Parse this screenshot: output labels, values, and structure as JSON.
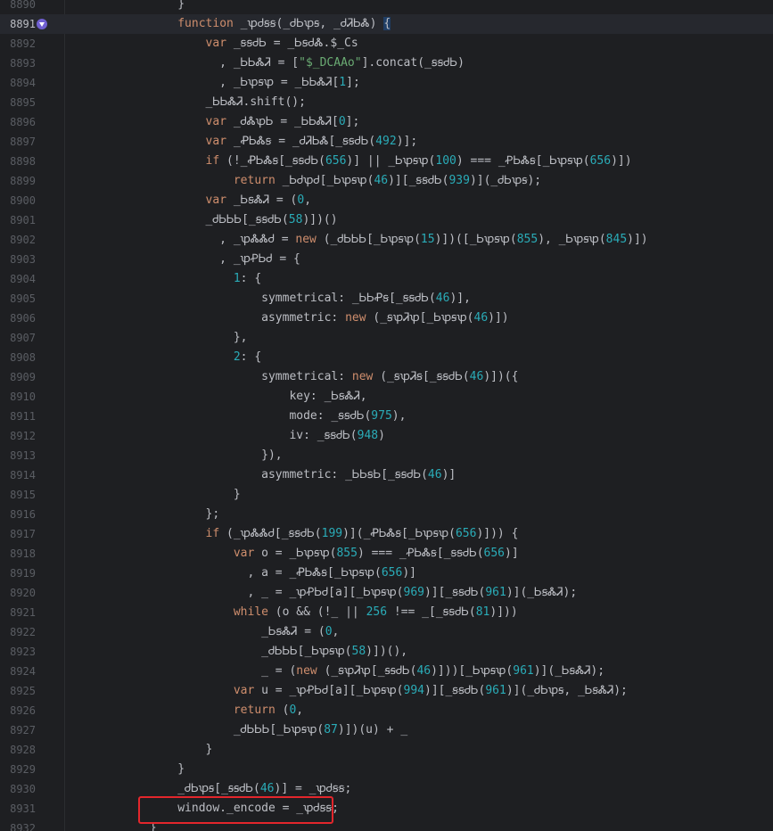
{
  "editor": {
    "accent_color": "#e3262c",
    "gutter_icon": "implementation-icon",
    "lines": [
      {
        "n": "8890",
        "segs": [
          {
            "t": "                }"
          }
        ]
      },
      {
        "n": "8891",
        "current": true,
        "segs": [
          {
            "t": "                "
          },
          {
            "t": "function",
            "c": "kw"
          },
          {
            "t": " _ꝕᏧꞩꞩ(_ᏧᏏꝕꞩ, _ᏧᏘᏏᏜ) "
          },
          {
            "t": "{",
            "c": "brk"
          }
        ]
      },
      {
        "n": "8892",
        "segs": [
          {
            "t": "                    "
          },
          {
            "t": "var",
            "c": "kw"
          },
          {
            "t": " _ꞩꞩᏧᏏ = _ᏏꞩᏧᏜ.$_Cs"
          }
        ]
      },
      {
        "n": "8893",
        "segs": [
          {
            "t": "                      , _ᏏᏏᏜᏘ = ["
          },
          {
            "t": "\"$_DCAAo\"",
            "c": "str"
          },
          {
            "t": "].concat(_ꞩꞩᏧᏏ)"
          }
        ]
      },
      {
        "n": "8894",
        "segs": [
          {
            "t": "                      , _Ꮟꝕꞩꝕ = _ᏏᏏᏜᏘ["
          },
          {
            "t": "1",
            "c": "num"
          },
          {
            "t": "];"
          }
        ]
      },
      {
        "n": "8895",
        "segs": [
          {
            "t": "                    _ᏏᏏᏜᏘ.shift();"
          }
        ]
      },
      {
        "n": "8896",
        "segs": [
          {
            "t": "                    "
          },
          {
            "t": "var",
            "c": "kw"
          },
          {
            "t": " _ᏧᏜꝕᏏ = _ᏏᏏᏜᏘ["
          },
          {
            "t": "0",
            "c": "num"
          },
          {
            "t": "];"
          }
        ]
      },
      {
        "n": "8897",
        "segs": [
          {
            "t": "                    "
          },
          {
            "t": "var",
            "c": "kw"
          },
          {
            "t": " _ꝒᏏᏜꞩ = _ᏧᏘᏏᏜ[_ꞩꞩᏧᏏ("
          },
          {
            "t": "492",
            "c": "num"
          },
          {
            "t": ")];"
          }
        ]
      },
      {
        "n": "8898",
        "segs": [
          {
            "t": "                    "
          },
          {
            "t": "if",
            "c": "kw"
          },
          {
            "t": " (!_ꝒᏏᏜꞩ[_ꞩꞩᏧᏏ("
          },
          {
            "t": "656",
            "c": "num"
          },
          {
            "t": ")] || _Ꮟꝕꞩꝕ("
          },
          {
            "t": "100",
            "c": "num"
          },
          {
            "t": ") === _ꝒᏏᏜꞩ[_Ꮟꝕꞩꝕ("
          },
          {
            "t": "656",
            "c": "num"
          },
          {
            "t": ")])"
          }
        ]
      },
      {
        "n": "8899",
        "segs": [
          {
            "t": "                        "
          },
          {
            "t": "return",
            "c": "kw"
          },
          {
            "t": " _ᏏᏧꝕᏧ[_Ꮟꝕꞩꝕ("
          },
          {
            "t": "46",
            "c": "num"
          },
          {
            "t": ")][_ꞩꞩᏧᏏ("
          },
          {
            "t": "939",
            "c": "num"
          },
          {
            "t": ")](_ᏧᏏꝕꞩ);"
          }
        ]
      },
      {
        "n": "8900",
        "segs": [
          {
            "t": "                    "
          },
          {
            "t": "var",
            "c": "kw"
          },
          {
            "t": " _ᏏꞩᏜᏘ = ("
          },
          {
            "t": "0",
            "c": "num"
          },
          {
            "t": ","
          }
        ]
      },
      {
        "n": "8901",
        "segs": [
          {
            "t": "                    _ᏧᏏᏏᏏ[_ꞩꞩᏧᏏ("
          },
          {
            "t": "58",
            "c": "num"
          },
          {
            "t": ")])()"
          }
        ]
      },
      {
        "n": "8902",
        "segs": [
          {
            "t": "                      , _ꝕᏜᏜᏧ = "
          },
          {
            "t": "new",
            "c": "kw"
          },
          {
            "t": " (_ᏧᏏᏏᏏ[_Ꮟꝕꞩꝕ("
          },
          {
            "t": "15",
            "c": "num"
          },
          {
            "t": ")])([_Ꮟꝕꞩꝕ("
          },
          {
            "t": "855",
            "c": "num"
          },
          {
            "t": "), _Ꮟꝕꞩꝕ("
          },
          {
            "t": "845",
            "c": "num"
          },
          {
            "t": ")])"
          }
        ]
      },
      {
        "n": "8903",
        "segs": [
          {
            "t": "                      , _ꝕꝒᏏᏧ = {"
          }
        ]
      },
      {
        "n": "8904",
        "segs": [
          {
            "t": "                        "
          },
          {
            "t": "1",
            "c": "num"
          },
          {
            "t": ": {"
          }
        ]
      },
      {
        "n": "8905",
        "segs": [
          {
            "t": "                            symmetrical: _ᏏᏏꝒꞩ[_ꞩꞩᏧᏏ("
          },
          {
            "t": "46",
            "c": "num"
          },
          {
            "t": ")],"
          }
        ]
      },
      {
        "n": "8906",
        "segs": [
          {
            "t": "                            asymmetric: "
          },
          {
            "t": "new",
            "c": "kw"
          },
          {
            "t": " (_ꞩꝕᏘꝕ[_Ꮟꝕꞩꝕ("
          },
          {
            "t": "46",
            "c": "num"
          },
          {
            "t": ")])"
          }
        ]
      },
      {
        "n": "8907",
        "segs": [
          {
            "t": "                        },"
          }
        ]
      },
      {
        "n": "8908",
        "segs": [
          {
            "t": "                        "
          },
          {
            "t": "2",
            "c": "num"
          },
          {
            "t": ": {"
          }
        ]
      },
      {
        "n": "8909",
        "segs": [
          {
            "t": "                            symmetrical: "
          },
          {
            "t": "new",
            "c": "kw"
          },
          {
            "t": " (_ꞩꝕᏘꞩ[_ꞩꞩᏧᏏ("
          },
          {
            "t": "46",
            "c": "num"
          },
          {
            "t": ")])({"
          }
        ]
      },
      {
        "n": "8910",
        "segs": [
          {
            "t": "                                key: _ᏏꞩᏜᏘ,"
          }
        ]
      },
      {
        "n": "8911",
        "segs": [
          {
            "t": "                                mode: _ꞩꞩᏧᏏ("
          },
          {
            "t": "975",
            "c": "num"
          },
          {
            "t": "),"
          }
        ]
      },
      {
        "n": "8912",
        "segs": [
          {
            "t": "                                iv: _ꞩꞩᏧᏏ("
          },
          {
            "t": "948",
            "c": "num"
          },
          {
            "t": ")"
          }
        ]
      },
      {
        "n": "8913",
        "segs": [
          {
            "t": "                            }),"
          }
        ]
      },
      {
        "n": "8914",
        "segs": [
          {
            "t": "                            asymmetric: _ᏏᏏꞩᏏ[_ꞩꞩᏧᏏ("
          },
          {
            "t": "46",
            "c": "num"
          },
          {
            "t": ")]"
          }
        ]
      },
      {
        "n": "8915",
        "segs": [
          {
            "t": "                        }"
          }
        ]
      },
      {
        "n": "8916",
        "segs": [
          {
            "t": "                    };"
          }
        ]
      },
      {
        "n": "8917",
        "segs": [
          {
            "t": "                    "
          },
          {
            "t": "if",
            "c": "kw"
          },
          {
            "t": " (_ꝕᏜᏜᏧ[_ꞩꞩᏧᏏ("
          },
          {
            "t": "199",
            "c": "num"
          },
          {
            "t": ")](_ꝒᏏᏜꞩ[_Ꮟꝕꞩꝕ("
          },
          {
            "t": "656",
            "c": "num"
          },
          {
            "t": ")])) {"
          }
        ]
      },
      {
        "n": "8918",
        "segs": [
          {
            "t": "                        "
          },
          {
            "t": "var",
            "c": "kw"
          },
          {
            "t": " o = _Ꮟꝕꞩꝕ("
          },
          {
            "t": "855",
            "c": "num"
          },
          {
            "t": ") === _ꝒᏏᏜꞩ[_ꞩꞩᏧᏏ("
          },
          {
            "t": "656",
            "c": "num"
          },
          {
            "t": ")]"
          }
        ]
      },
      {
        "n": "8919",
        "segs": [
          {
            "t": "                          , a = _ꝒᏏᏜꞩ[_Ꮟꝕꞩꝕ("
          },
          {
            "t": "656",
            "c": "num"
          },
          {
            "t": ")]"
          }
        ]
      },
      {
        "n": "8920",
        "segs": [
          {
            "t": "                          , _ = _ꝕꝒᏏᏧ[a][_Ꮟꝕꞩꝕ("
          },
          {
            "t": "969",
            "c": "num"
          },
          {
            "t": ")][_ꞩꞩᏧᏏ("
          },
          {
            "t": "961",
            "c": "num"
          },
          {
            "t": ")](_ᏏꞩᏜᏘ);"
          }
        ]
      },
      {
        "n": "8921",
        "segs": [
          {
            "t": "                        "
          },
          {
            "t": "while",
            "c": "kw"
          },
          {
            "t": " (o && (!_ || "
          },
          {
            "t": "256",
            "c": "num"
          },
          {
            "t": " !== _[_ꞩꞩᏧᏏ("
          },
          {
            "t": "81",
            "c": "num"
          },
          {
            "t": ")]))"
          }
        ]
      },
      {
        "n": "8922",
        "segs": [
          {
            "t": "                            _ᏏꞩᏜᏘ = ("
          },
          {
            "t": "0",
            "c": "num"
          },
          {
            "t": ","
          }
        ]
      },
      {
        "n": "8923",
        "segs": [
          {
            "t": "                            _ᏧᏏᏏᏏ[_Ꮟꝕꞩꝕ("
          },
          {
            "t": "58",
            "c": "num"
          },
          {
            "t": ")])(),"
          }
        ]
      },
      {
        "n": "8924",
        "segs": [
          {
            "t": "                            _ = ("
          },
          {
            "t": "new",
            "c": "kw"
          },
          {
            "t": " (_ꞩꝕᏘꝕ[_ꞩꞩᏧᏏ("
          },
          {
            "t": "46",
            "c": "num"
          },
          {
            "t": ")]))[_Ꮟꝕꞩꝕ("
          },
          {
            "t": "961",
            "c": "num"
          },
          {
            "t": ")](_ᏏꞩᏜᏘ);"
          }
        ]
      },
      {
        "n": "8925",
        "segs": [
          {
            "t": "                        "
          },
          {
            "t": "var",
            "c": "kw"
          },
          {
            "t": " u = _ꝕꝒᏏᏧ[a][_Ꮟꝕꞩꝕ("
          },
          {
            "t": "994",
            "c": "num"
          },
          {
            "t": ")][_ꞩꞩᏧᏏ("
          },
          {
            "t": "961",
            "c": "num"
          },
          {
            "t": ")](_ᏧᏏꝕꞩ, _ᏏꞩᏜᏘ);"
          }
        ]
      },
      {
        "n": "8926",
        "segs": [
          {
            "t": "                        "
          },
          {
            "t": "return",
            "c": "kw"
          },
          {
            "t": " ("
          },
          {
            "t": "0",
            "c": "num"
          },
          {
            "t": ","
          }
        ]
      },
      {
        "n": "8927",
        "segs": [
          {
            "t": "                        _ᏧᏏᏏᏏ[_Ꮟꝕꞩꝕ("
          },
          {
            "t": "87",
            "c": "num"
          },
          {
            "t": ")])(u) + _"
          }
        ]
      },
      {
        "n": "8928",
        "segs": [
          {
            "t": "                    }"
          }
        ]
      },
      {
        "n": "8929",
        "segs": [
          {
            "t": "                }"
          }
        ]
      },
      {
        "n": "8930",
        "segs": [
          {
            "t": "                _ᏧᏏꝕꞩ[_ꞩꞩᏧᏏ("
          },
          {
            "t": "46",
            "c": "num"
          },
          {
            "t": ")] = _ꝕᏧꞩꞩ;"
          }
        ]
      },
      {
        "n": "8931",
        "segs": [
          {
            "t": "                window._encode = _ꝕᏧꞩꞩ;"
          }
        ]
      },
      {
        "n": "8932",
        "segs": [
          {
            "t": "            }"
          }
        ]
      }
    ]
  }
}
